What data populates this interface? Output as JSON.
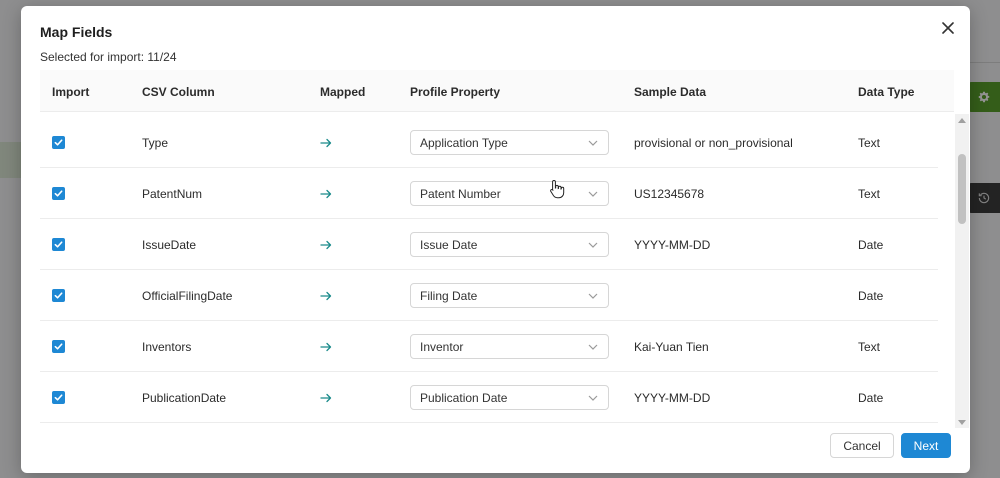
{
  "modal": {
    "title": "Map Fields",
    "selected_for_import": "Selected for import: 11/24",
    "close_icon": "close-icon"
  },
  "table": {
    "columns": [
      "Import",
      "CSV Column",
      "Mapped",
      "Profile Property",
      "Sample Data",
      "Data Type"
    ],
    "rows": [
      {
        "checked": true,
        "csv_column": "Type",
        "property": "Application Type",
        "sample": "provisional or non_provisional",
        "data_type": "Text"
      },
      {
        "checked": true,
        "csv_column": "PatentNum",
        "property": "Patent Number",
        "sample": "US12345678",
        "data_type": "Text"
      },
      {
        "checked": true,
        "csv_column": "IssueDate",
        "property": "Issue Date",
        "sample": "YYYY-MM-DD",
        "data_type": "Date"
      },
      {
        "checked": true,
        "csv_column": "OfficialFilingDate",
        "property": "Filing Date",
        "sample": "",
        "data_type": "Date"
      },
      {
        "checked": true,
        "csv_column": "Inventors",
        "property": "Inventor",
        "sample": "Kai-Yuan Tien",
        "data_type": "Text"
      },
      {
        "checked": true,
        "csv_column": "PublicationDate",
        "property": "Publication Date",
        "sample": "YYYY-MM-DD",
        "data_type": "Date"
      }
    ]
  },
  "footer": {
    "cancel_label": "Cancel",
    "next_label": "Next"
  },
  "colors": {
    "accent": "#1e88d4",
    "mapped_arrow": "#1a8a8a",
    "background_action": "#5aa02c"
  }
}
